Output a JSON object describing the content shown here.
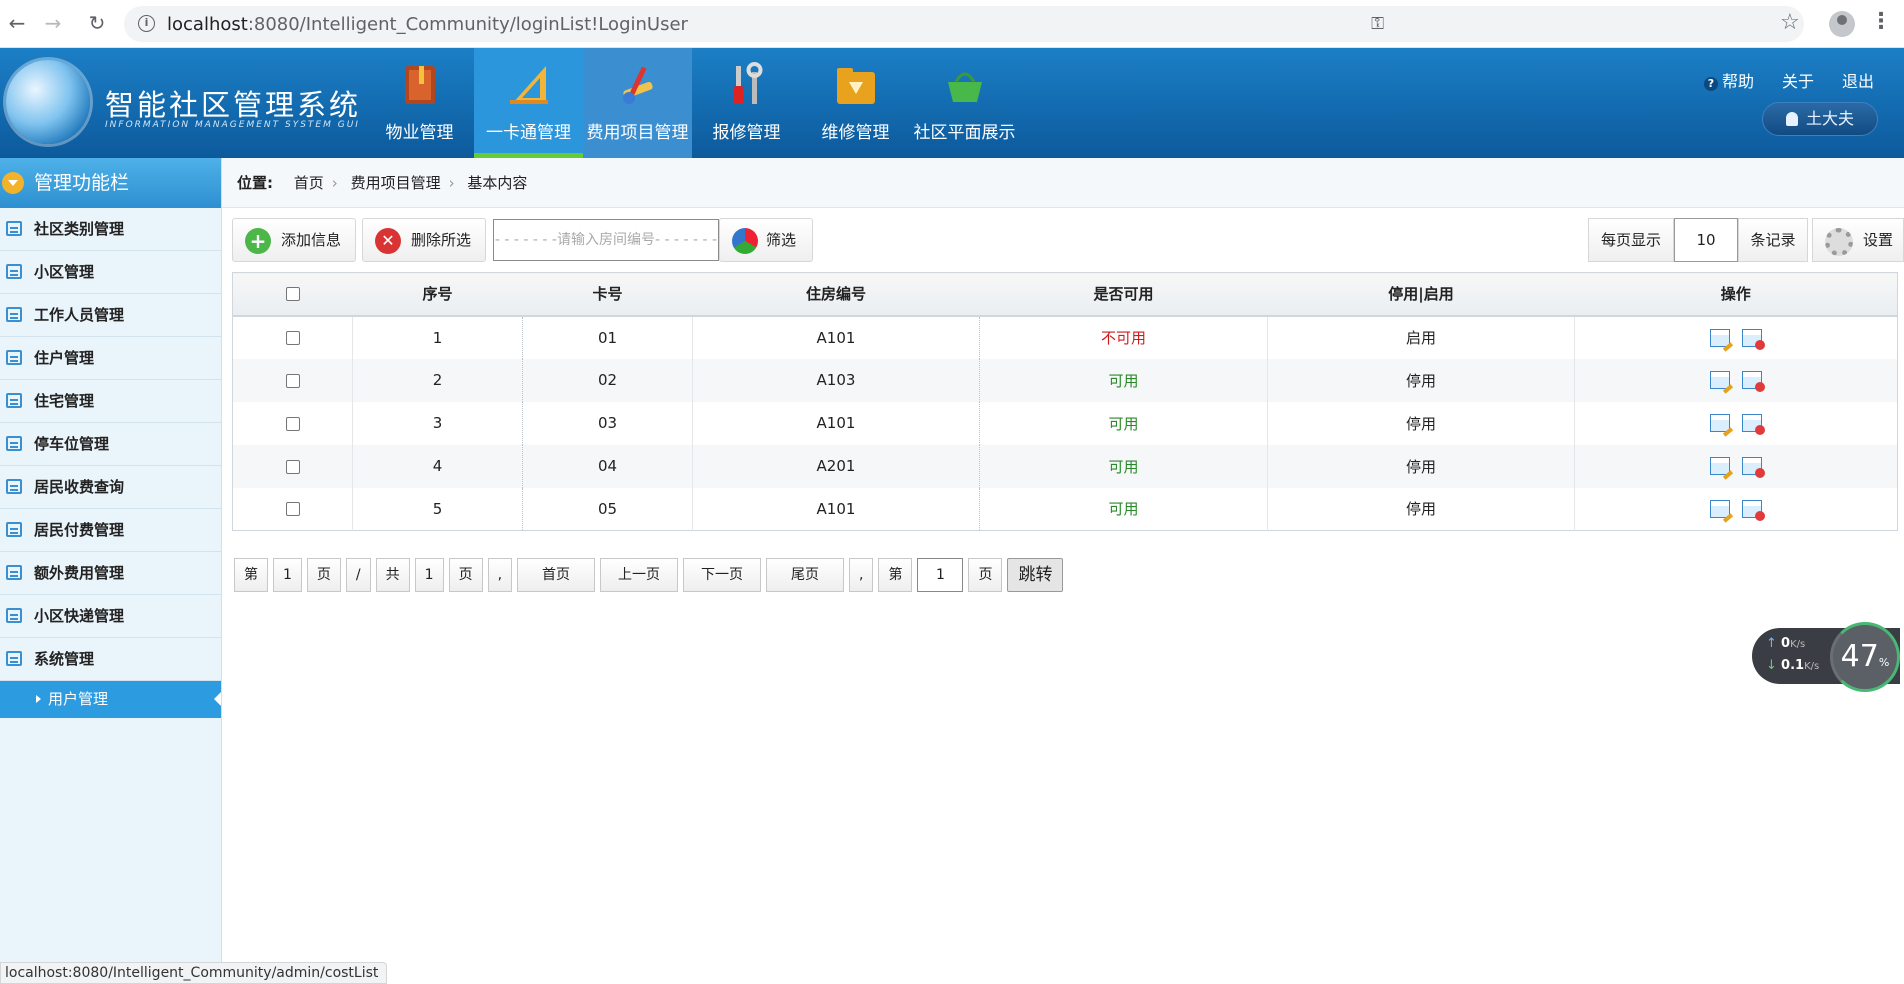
{
  "browser": {
    "url_host": "localhost",
    "url_rest": ":8080/Intelligent_Community/loginList!LoginUser",
    "status_url": "localhost:8080/Intelligent_Community/admin/costList"
  },
  "header": {
    "title": "智能社区管理系统",
    "subtitle": "INFORMATION MANAGEMENT SYSTEM GUI",
    "nav": [
      {
        "label": "物业管理",
        "icon": "book-icon"
      },
      {
        "label": "一卡通管理",
        "icon": "ruler-icon"
      },
      {
        "label": "费用项目管理",
        "icon": "tools-icon"
      },
      {
        "label": "报修管理",
        "icon": "wrench-icon"
      },
      {
        "label": "维修管理",
        "icon": "folder-icon"
      },
      {
        "label": "社区平面展示",
        "icon": "basket-icon"
      }
    ],
    "help": "帮助",
    "about": "关于",
    "logout": "退出",
    "user": "土大夫"
  },
  "sidebar": {
    "title": "管理功能栏",
    "items": [
      "社区类别管理",
      "小区管理",
      "工作人员管理",
      "住户管理",
      "住宅管理",
      "停车位管理",
      "居民收费查询",
      "居民付费管理",
      "额外费用管理",
      "小区快递管理",
      "系统管理"
    ],
    "sub_item": "用户管理"
  },
  "breadcrumb": {
    "label": "位置:",
    "home": "首页",
    "section": "费用项目管理",
    "current": "基本内容"
  },
  "toolbar": {
    "add": "添加信息",
    "delete": "删除所选",
    "search_placeholder": "- - - - - - -请输入房间编号- - - - - - -",
    "filter": "筛选",
    "per_page_label": "每页显示",
    "per_page_value": "10",
    "records_label": "条记录",
    "settings": "设置"
  },
  "table": {
    "headers": [
      "序号",
      "卡号",
      "住房编号",
      "是否可用",
      "停用|启用",
      "操作"
    ],
    "rows": [
      {
        "no": "1",
        "card": "01",
        "room": "A101",
        "available": "不可用",
        "toggle": "启用"
      },
      {
        "no": "2",
        "card": "02",
        "room": "A103",
        "available": "可用",
        "toggle": "停用"
      },
      {
        "no": "3",
        "card": "03",
        "room": "A101",
        "available": "可用",
        "toggle": "停用"
      },
      {
        "no": "4",
        "card": "04",
        "room": "A201",
        "available": "可用",
        "toggle": "停用"
      },
      {
        "no": "5",
        "card": "05",
        "room": "A101",
        "available": "可用",
        "toggle": "停用"
      }
    ]
  },
  "pager": {
    "di": "第",
    "cur": "1",
    "ye": "页",
    "slash": "/",
    "gong": "共",
    "total": "1",
    "ye2": "页",
    "comma": ",",
    "first": "首页",
    "prev": "上一页",
    "next": "下一页",
    "last": "尾页",
    "comma2": ",",
    "di2": "第",
    "input": "1",
    "ye3": "页",
    "jump": "跳转"
  },
  "netwidget": {
    "up": "0",
    "up_unit": "K/s",
    "down": "0.1",
    "down_unit": "K/s",
    "percent": "47",
    "percent_unit": "%"
  }
}
